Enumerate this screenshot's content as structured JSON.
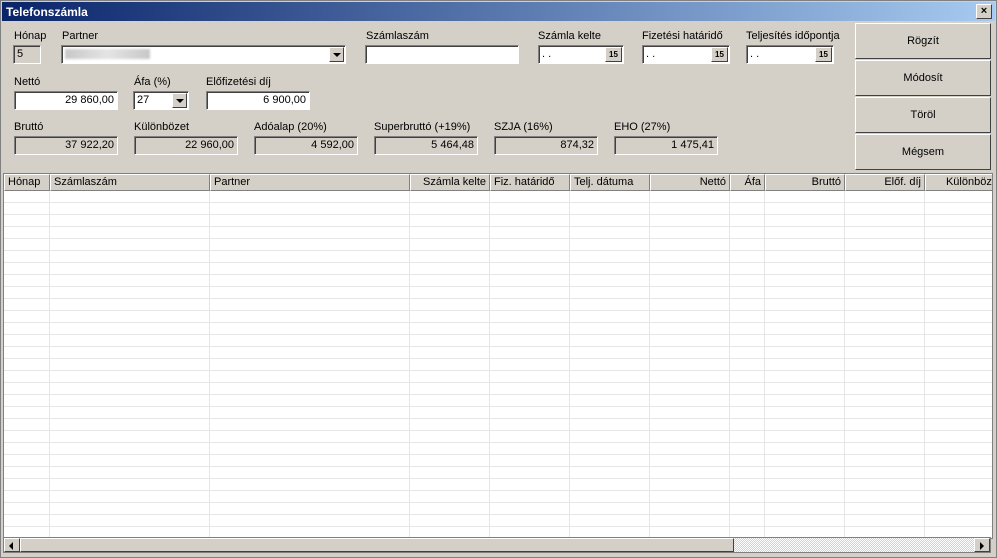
{
  "window": {
    "title": "Telefonszámla",
    "close_glyph": "×"
  },
  "form": {
    "honap": {
      "label": "Hónap",
      "value": "5"
    },
    "partner": {
      "label": "Partner",
      "value": ""
    },
    "szamlaszam": {
      "label": "Számlaszám",
      "value": ""
    },
    "szamla_kelte": {
      "label": "Számla kelte",
      "value": " .  ."
    },
    "fizetesi_hatarido": {
      "label": "Fizetési határidő",
      "value": " .  ."
    },
    "teljesites_idopontja": {
      "label": "Teljesítés időpontja",
      "value": " .  ."
    },
    "calendar_icon_text": "15",
    "netto": {
      "label": "Nettó",
      "value": "29 860,00"
    },
    "afa": {
      "label": "Áfa (%)",
      "value": "27"
    },
    "elofizetesi_dij": {
      "label": "Előfizetési díj",
      "value": "6 900,00"
    },
    "brutto": {
      "label": "Bruttó",
      "value": "37 922,20"
    },
    "kulonbozet": {
      "label": "Különbözet",
      "value": "22 960,00"
    },
    "adoalap": {
      "label": "Adóalap (20%)",
      "value": "4 592,00"
    },
    "superbrutto": {
      "label": "Superbruttó (+19%)",
      "value": "5 464,48"
    },
    "szja": {
      "label": "SZJA (16%)",
      "value": "874,32"
    },
    "eho": {
      "label": "EHO (27%)",
      "value": "1 475,41"
    }
  },
  "buttons": {
    "rogzit": "Rögzít",
    "modosit": "Módosít",
    "torol": "Töröl",
    "megsem": "Mégsem"
  },
  "table": {
    "columns": [
      "Hónap",
      "Számlaszám",
      "Partner",
      "Számla kelte",
      "Fiz. határidő",
      "Telj. dátuma",
      "Nettó",
      "Áfa",
      "Bruttó",
      "Előf. díj",
      "Különbözet"
    ]
  },
  "icons": {
    "close": "close-icon",
    "dropdown": "chevron-down-icon",
    "calendar": "calendar-icon",
    "scroll_left": "arrow-left-icon",
    "scroll_right": "arrow-right-icon"
  }
}
